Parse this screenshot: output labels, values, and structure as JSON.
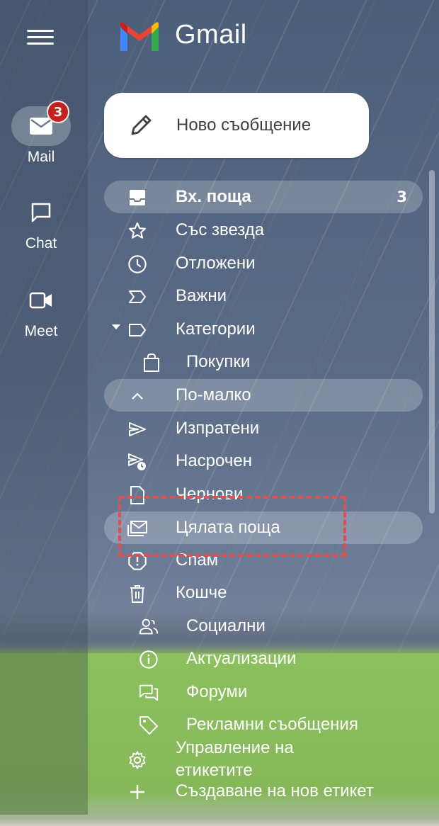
{
  "header": {
    "app_title": "Gmail"
  },
  "rail": {
    "items": [
      {
        "label": "Mail",
        "badge": "3",
        "icon": "mail-icon"
      },
      {
        "label": "Chat",
        "icon": "chat-icon"
      },
      {
        "label": "Meet",
        "icon": "video-icon"
      }
    ]
  },
  "compose": {
    "label": "Ново съобщение"
  },
  "folders": [
    {
      "label": "Вх. поща",
      "count": "3",
      "icon": "inbox-icon"
    },
    {
      "label": "Със звезда",
      "icon": "star-icon"
    },
    {
      "label": "Отложени",
      "icon": "clock-icon"
    },
    {
      "label": "Важни",
      "icon": "important-icon"
    },
    {
      "label": "Категории",
      "icon": "label-icon"
    },
    {
      "label": "Покупки",
      "icon": "shopping-bag-icon"
    },
    {
      "label": "По-малко",
      "icon": "chevron-up-icon"
    },
    {
      "label": "Изпратени",
      "icon": "send-icon"
    },
    {
      "label": "Насрочен",
      "icon": "scheduled-send-icon"
    },
    {
      "label": "Чернови",
      "icon": "draft-icon"
    },
    {
      "label": "Цялата поща",
      "icon": "all-mail-icon"
    },
    {
      "label": "Спам",
      "icon": "spam-icon"
    },
    {
      "label": "Кошче",
      "icon": "trash-icon"
    },
    {
      "label": "Социални",
      "icon": "people-icon"
    },
    {
      "label": "Актуализации",
      "icon": "info-icon"
    },
    {
      "label": "Форуми",
      "icon": "forum-icon"
    },
    {
      "label": "Рекламни съобщения",
      "icon": "tag-icon"
    }
  ],
  "footer": {
    "manage_labels_line1": "Управление на",
    "manage_labels_line2": "етикетите",
    "create_label": "Създаване на нов етикет"
  },
  "colors": {
    "badge": "#c5221f",
    "highlight_box": "#e05050"
  }
}
